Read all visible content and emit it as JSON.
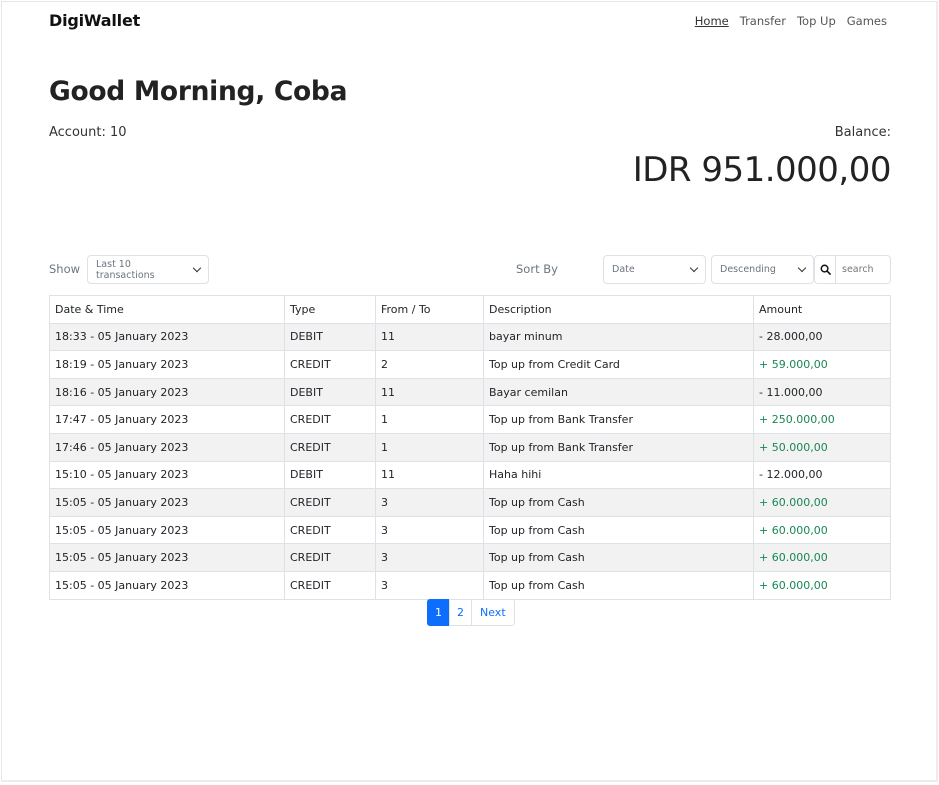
{
  "brand": "DigiWallet",
  "nav": [
    "Home",
    "Transfer",
    "Top Up",
    "Games"
  ],
  "greeting": "Good Morning, Coba",
  "account": "Account: 10",
  "balance_label": "Balance:",
  "balance_value": "IDR 951.000,00",
  "filters": {
    "show_label": "Show",
    "show_value": "Last 10 transactions",
    "sort_label": "Sort By",
    "sort_field": "Date",
    "sort_order": "Descending",
    "search_placeholder": "search"
  },
  "table": {
    "headers": [
      "Date & Time",
      "Type",
      "From / To",
      "Description",
      "Amount"
    ],
    "rows": [
      [
        "18:33 - 05 January 2023",
        "DEBIT",
        "11",
        "bayar minum",
        "- 28.000,00"
      ],
      [
        "18:19 - 05 January 2023",
        "CREDIT",
        "2",
        "Top up from Credit Card",
        "+ 59.000,00"
      ],
      [
        "18:16 - 05 January 2023",
        "DEBIT",
        "11",
        "Bayar cemilan",
        "- 11.000,00"
      ],
      [
        "17:47 - 05 January 2023",
        "CREDIT",
        "1",
        "Top up from Bank Transfer",
        "+ 250.000,00"
      ],
      [
        "17:46 - 05 January 2023",
        "CREDIT",
        "1",
        "Top up from Bank Transfer",
        "+ 50.000,00"
      ],
      [
        "15:10 - 05 January 2023",
        "DEBIT",
        "11",
        "Haha hihi",
        "- 12.000,00"
      ],
      [
        "15:05 - 05 January 2023",
        "CREDIT",
        "3",
        "Top up from Cash",
        "+ 60.000,00"
      ],
      [
        "15:05 - 05 January 2023",
        "CREDIT",
        "3",
        "Top up from Cash",
        "+ 60.000,00"
      ],
      [
        "15:05 - 05 January 2023",
        "CREDIT",
        "3",
        "Top up from Cash",
        "+ 60.000,00"
      ],
      [
        "15:05 - 05 January 2023",
        "CREDIT",
        "3",
        "Top up from Cash",
        "+ 60.000,00"
      ]
    ]
  },
  "pagination": [
    "1",
    "2",
    "Next"
  ],
  "colors": {
    "credit": "#198754",
    "primary": "#0d6efd"
  }
}
